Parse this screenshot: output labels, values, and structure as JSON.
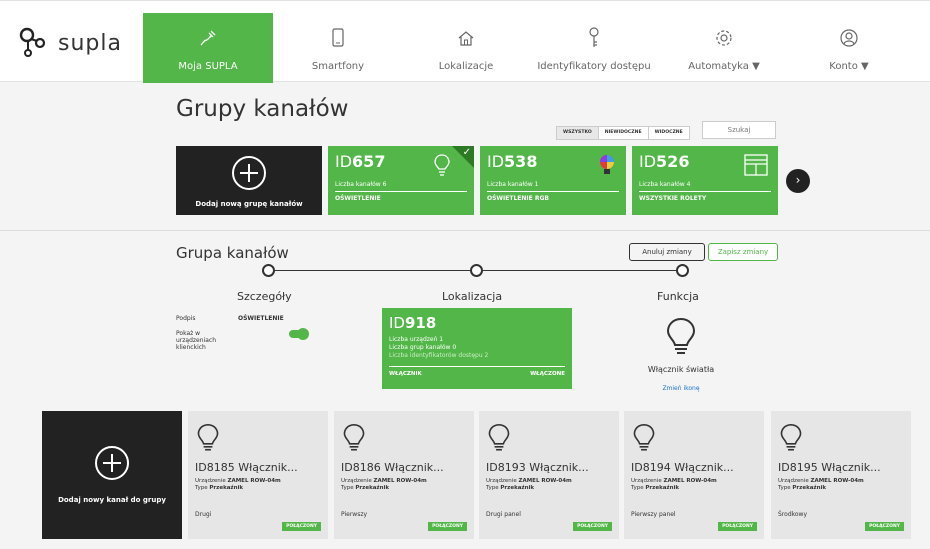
{
  "brand": {
    "name": "supla"
  },
  "nav": [
    {
      "label": "Moja SUPLA",
      "icon": "plug-icon",
      "active": true
    },
    {
      "label": "Smartfony",
      "icon": "smartphone-icon"
    },
    {
      "label": "Lokalizacje",
      "icon": "home-icon"
    },
    {
      "label": "Identyfikatory dostępu",
      "icon": "key-icon"
    },
    {
      "label": "Automatyka ▼",
      "icon": "gear-icon"
    },
    {
      "label": "Konto ▼",
      "icon": "user-icon"
    }
  ],
  "groups_section": {
    "title": "Grupy kanałów",
    "filters": [
      "WSZYSTKO",
      "NIEWIDOCZNE",
      "WIDOCZNE"
    ],
    "active_filter": "WSZYSTKO",
    "search_placeholder": "Szukaj",
    "add_label": "Dodaj nową grupę kanałów",
    "cards": [
      {
        "id_prefix": "ID",
        "id_num": "657",
        "count": "Liczba kanałów 6",
        "function": "OŚWIETLENIE",
        "icon": "lightbulb-icon",
        "selected": true
      },
      {
        "id_prefix": "ID",
        "id_num": "538",
        "count": "Liczba kanałów 1",
        "function": "OŚWIETLENIE RGB",
        "icon": "rgb-lightbulb-icon",
        "selected": false
      },
      {
        "id_prefix": "ID",
        "id_num": "526",
        "count": "Liczba kanałów 4",
        "function": "WSZYSTKIE ROLETY",
        "icon": "roller-shutter-icon",
        "selected": false
      }
    ],
    "next_label": "›"
  },
  "group_detail": {
    "title": "Grupa kanałów",
    "cancel_label": "Anuluj zmiany",
    "save_label": "Zapisz zmiany",
    "steps": [
      "Szczegóły",
      "Lokalizacja",
      "Funkcja"
    ],
    "details": {
      "caption_label": "Podpis",
      "caption_value": "OŚWIETLENIE",
      "show_label_lines": [
        "Pokaż w",
        "urządzeniach",
        "klienckich"
      ],
      "show_in_clients": true
    },
    "location": {
      "id_prefix": "ID",
      "id_num": "918",
      "devices": "Liczba urządzeń 1",
      "groups": "Liczba grup kanałów 0",
      "access_ids": "Liczba identyfikatorów dostępu 2",
      "switch_label": "WŁĄCZNIK",
      "status": "WŁĄCZONE"
    },
    "function": {
      "name": "Włącznik światła",
      "change_icon": "Zmień ikonę",
      "icon": "lightbulb-icon"
    }
  },
  "channels": {
    "add_label": "Dodaj nowy kanał do grupy",
    "device_prefix": "Urządzenie",
    "type_prefix": "Type",
    "items": [
      {
        "id": "ID8185 Włącznik...",
        "device": "ZAMEL ROW-04m",
        "type": "Przekaźnik",
        "name": "Drugi",
        "status": "POŁĄCZONY"
      },
      {
        "id": "ID8186 Włącznik...",
        "device": "ZAMEL ROW-04m",
        "type": "Przekaźnik",
        "name": "Pierwszy",
        "status": "POŁĄCZONY"
      },
      {
        "id": "ID8193 Włącznik...",
        "device": "ZAMEL ROW-04m",
        "type": "Przekaźnik",
        "name": "Drugi panel",
        "status": "POŁĄCZONY"
      },
      {
        "id": "ID8194 Włącznik...",
        "device": "ZAMEL ROW-04m",
        "type": "Przekaźnik",
        "name": "Pierwszy panel",
        "status": "POŁĄCZONY"
      },
      {
        "id": "ID8195 Włącznik...",
        "device": "ZAMEL ROW-04m",
        "type": "Przekaźnik",
        "name": "Środkowy",
        "status": "POŁĄCZONY"
      }
    ]
  },
  "colors": {
    "accent": "#52b748",
    "dark": "#222222",
    "link": "#1a73c9"
  }
}
